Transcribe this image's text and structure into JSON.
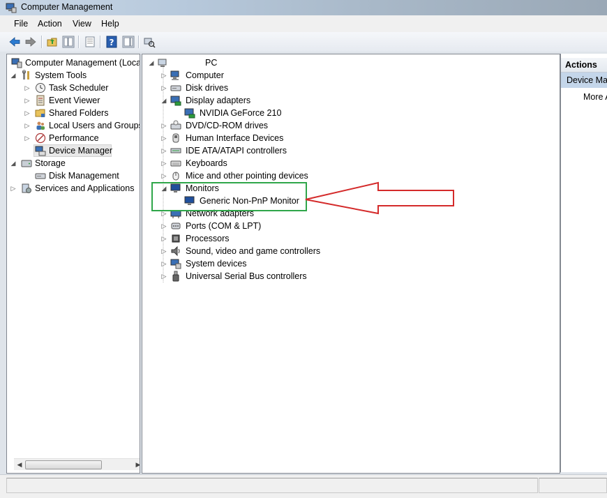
{
  "window": {
    "title": "Computer Management"
  },
  "menu": {
    "items": [
      "File",
      "Action",
      "View",
      "Help"
    ]
  },
  "left_tree": {
    "root": "Computer Management (Local",
    "items": [
      {
        "label": "System Tools",
        "level": 1,
        "expander": "open",
        "icon": "tools-icon"
      },
      {
        "label": "Task Scheduler",
        "level": 2,
        "expander": "closed",
        "icon": "clock-icon"
      },
      {
        "label": "Event Viewer",
        "level": 2,
        "expander": "closed",
        "icon": "event-log-icon"
      },
      {
        "label": "Shared Folders",
        "level": 2,
        "expander": "closed",
        "icon": "shared-folder-icon"
      },
      {
        "label": "Local Users and Groups",
        "level": 2,
        "expander": "closed",
        "icon": "users-icon"
      },
      {
        "label": "Performance",
        "level": 2,
        "expander": "closed",
        "icon": "performance-icon"
      },
      {
        "label": "Device Manager",
        "level": 2,
        "expander": "none",
        "icon": "device-manager-icon",
        "selected": true
      },
      {
        "label": "Storage",
        "level": 1,
        "expander": "open",
        "icon": "storage-icon"
      },
      {
        "label": "Disk Management",
        "level": 2,
        "expander": "none",
        "icon": "disk-icon"
      },
      {
        "label": "Services and Applications",
        "level": 1,
        "expander": "closed",
        "icon": "services-icon"
      }
    ]
  },
  "device_tree": {
    "root": "PC",
    "items": [
      {
        "label": "Computer",
        "level": 1,
        "expander": "closed",
        "icon": "computer-icon"
      },
      {
        "label": "Disk drives",
        "level": 1,
        "expander": "closed",
        "icon": "disk-drive-icon"
      },
      {
        "label": "Display adapters",
        "level": 1,
        "expander": "open",
        "icon": "display-adapter-icon"
      },
      {
        "label": "NVIDIA GeForce 210",
        "level": 2,
        "expander": "none",
        "icon": "display-adapter-icon"
      },
      {
        "label": "DVD/CD-ROM drives",
        "level": 1,
        "expander": "closed",
        "icon": "dvd-drive-icon"
      },
      {
        "label": "Human Interface Devices",
        "level": 1,
        "expander": "closed",
        "icon": "hid-icon"
      },
      {
        "label": "IDE ATA/ATAPI controllers",
        "level": 1,
        "expander": "closed",
        "icon": "ide-controller-icon"
      },
      {
        "label": "Keyboards",
        "level": 1,
        "expander": "closed",
        "icon": "keyboard-icon"
      },
      {
        "label": "Mice and other pointing devices",
        "level": 1,
        "expander": "closed",
        "icon": "mouse-icon"
      },
      {
        "label": "Monitors",
        "level": 1,
        "expander": "open",
        "icon": "monitor-icon"
      },
      {
        "label": "Generic Non-PnP Monitor",
        "level": 2,
        "expander": "none",
        "icon": "monitor-icon"
      },
      {
        "label": "Network adapters",
        "level": 1,
        "expander": "closed",
        "icon": "network-adapter-icon"
      },
      {
        "label": "Ports (COM & LPT)",
        "level": 1,
        "expander": "closed",
        "icon": "port-icon"
      },
      {
        "label": "Processors",
        "level": 1,
        "expander": "closed",
        "icon": "processor-icon"
      },
      {
        "label": "Sound, video and game controllers",
        "level": 1,
        "expander": "closed",
        "icon": "sound-icon"
      },
      {
        "label": "System devices",
        "level": 1,
        "expander": "closed",
        "icon": "system-device-icon"
      },
      {
        "label": "Universal Serial Bus controllers",
        "level": 1,
        "expander": "closed",
        "icon": "usb-icon"
      }
    ]
  },
  "actions": {
    "header": "Actions",
    "section": "Device Mar",
    "more": "More A"
  },
  "annotation": {
    "highlight_color": "#2fa64a",
    "arrow_color": "#d42a2a"
  }
}
